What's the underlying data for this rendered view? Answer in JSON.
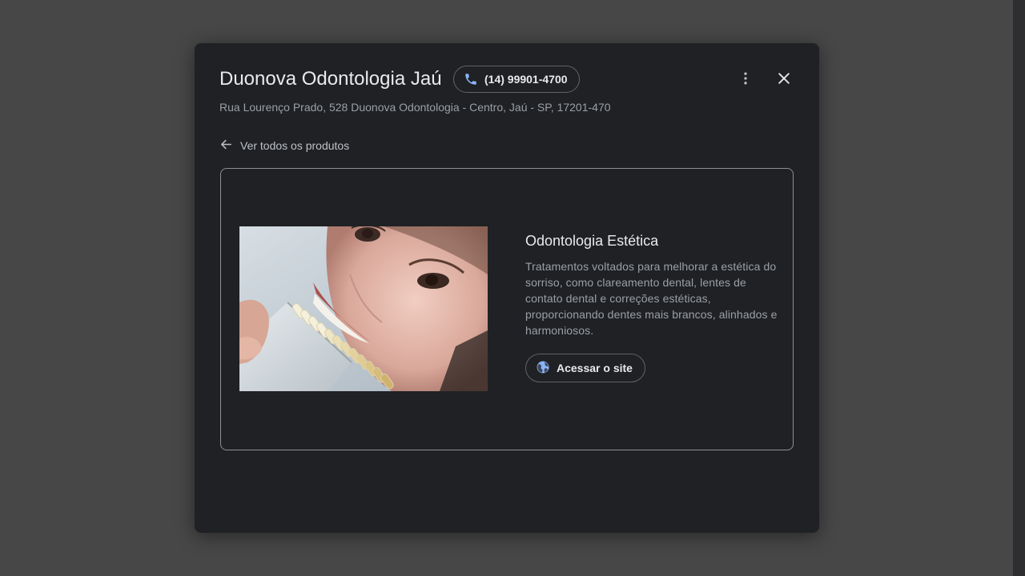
{
  "dialog": {
    "title": "Duonova Odontologia Jaú",
    "phone": "(14) 99901-4700",
    "address": "Rua Lourenço Prado, 528 Duonova Odontologia - Centro, Jaú - SP, 17201-470",
    "back_label": "Ver todos os produtos",
    "icons": {
      "phone": "phone-icon",
      "more": "more-vert-icon",
      "close": "close-icon",
      "back": "arrow-back-icon",
      "site": "globe-icon"
    }
  },
  "product": {
    "title": "Odontologia Estética",
    "description": "Tratamentos voltados para melhorar a estética do sorriso, como clareamento dental, lentes de contato dental e correções estéticas, proporcionando dentes mais brancos, alinhados e harmoniosos.",
    "site_button_label": "Acessar o site"
  },
  "colors": {
    "dialog_bg": "#202124",
    "backdrop": "#474747",
    "accent_blue": "#8ab4f8"
  }
}
